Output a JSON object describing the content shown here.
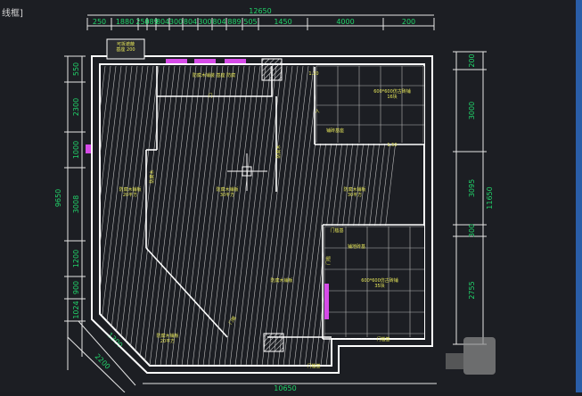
{
  "tab_title": "线框]",
  "dimensions": {
    "top_total": "12650",
    "top_segments": [
      "250",
      "1880",
      "250",
      "889",
      "804",
      "300",
      "804",
      "300",
      "804",
      "889",
      "505",
      "1450",
      "4000",
      "200"
    ],
    "left_segments": [
      "550",
      "2300",
      "1000",
      "3008",
      "1200",
      "900",
      "1024"
    ],
    "left_total": "9650",
    "right_segments": [
      "200",
      "3000",
      "3095",
      "300",
      "2755"
    ],
    "right_total": "11650",
    "bottom_total": "10650",
    "diag_upper": "1300",
    "diag_lower": "2200"
  },
  "rooms": {
    "entry_box": "可拆遮蔽\n基座 200",
    "top_corridor": "防腐木铺装 基座 防腐",
    "room_left": "防腐木铺板\n20平方",
    "room_center": "防腐木铺板\n30平方",
    "room_right": "防腐木铺板\n30平方",
    "top_right": "600*600仿古砖铺\n16块",
    "top_right_sub": "铺砖基座",
    "bottom_right": "600*600仿古砖铺\n35块",
    "bottom_right_top": "门槛基",
    "bottom_right_sub": "铺地砖基",
    "center_bottom": "防腐木铺板",
    "bottom_left": "防腐木铺板\n20平方",
    "bottom_sub": "门槛基",
    "bottom_edge": "门槛基",
    "vert_left": "防腐木",
    "vert_center": "防腐木",
    "vert_right": "门槛",
    "diag_label": "门槛",
    "door_a": "门",
    "door_b": "入",
    "door_c": "1.20",
    "door_d": "1.50"
  }
}
